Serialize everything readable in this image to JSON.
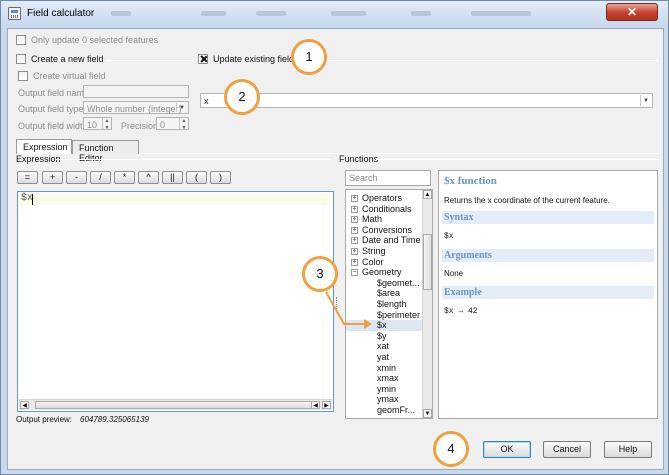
{
  "window": {
    "title": "Field calculator",
    "close_glyph": "✕",
    "icon": "field-calculator-icon"
  },
  "options": {
    "only_selected": "Only update 0 selected features",
    "create_new": "Create a new field",
    "update_existing": "Update existing field",
    "create_virtual": "Create virtual field",
    "output_name_label": "Output field name",
    "output_type_label": "Output field type",
    "output_type_value": "Whole number (integer)",
    "output_width_label": "Output field width",
    "output_width_value": "10",
    "precision_label": "Precision",
    "precision_value": "0",
    "existing_field_value": "x"
  },
  "tabs": [
    {
      "label": "Expression",
      "active": true
    },
    {
      "label": "Function Editor",
      "active": false
    }
  ],
  "expression": {
    "section_title": "Expression",
    "operators": [
      "=",
      "+",
      "-",
      "/",
      "*",
      "^",
      "||",
      "(",
      ")"
    ],
    "text": "$x"
  },
  "functions": {
    "section_title": "Functions",
    "search_placeholder": "Search",
    "tree": [
      {
        "label": "Operators",
        "level": 0,
        "expander": "+"
      },
      {
        "label": "Conditionals",
        "level": 0,
        "expander": "+"
      },
      {
        "label": "Math",
        "level": 0,
        "expander": "+"
      },
      {
        "label": "Conversions",
        "level": 0,
        "expander": "+"
      },
      {
        "label": "Date and Time",
        "level": 0,
        "expander": "+"
      },
      {
        "label": "String",
        "level": 0,
        "expander": "+"
      },
      {
        "label": "Color",
        "level": 0,
        "expander": "+"
      },
      {
        "label": "Geometry",
        "level": 0,
        "expander": "−"
      },
      {
        "label": "$geomet...",
        "level": 1
      },
      {
        "label": "$area",
        "level": 1
      },
      {
        "label": "$length",
        "level": 1
      },
      {
        "label": "$perimeter",
        "level": 1
      },
      {
        "label": "$x",
        "level": 1,
        "selected": true
      },
      {
        "label": "$y",
        "level": 1
      },
      {
        "label": "xat",
        "level": 1
      },
      {
        "label": "yat",
        "level": 1
      },
      {
        "label": "xmin",
        "level": 1
      },
      {
        "label": "xmax",
        "level": 1
      },
      {
        "label": "ymin",
        "level": 1
      },
      {
        "label": "ymax",
        "level": 1
      },
      {
        "label": "geomFr...",
        "level": 1
      }
    ]
  },
  "help": {
    "title": "$x function",
    "description": "Returns the x coordinate of the current feature.",
    "syntax_heading": "Syntax",
    "syntax": "$x",
    "arguments_heading": "Arguments",
    "arguments": "None",
    "example_heading": "Example",
    "example": "$x → 42"
  },
  "preview": {
    "label": "Output preview:",
    "value": "604789.325065139"
  },
  "buttons": {
    "ok": "OK",
    "cancel": "Cancel",
    "help": "Help"
  },
  "callouts": [
    "1",
    "2",
    "3",
    "4"
  ],
  "colors": {
    "callout_border": "#f0a040",
    "help_heading": "#6f94c3",
    "editor_focus": "#5f97d9"
  }
}
